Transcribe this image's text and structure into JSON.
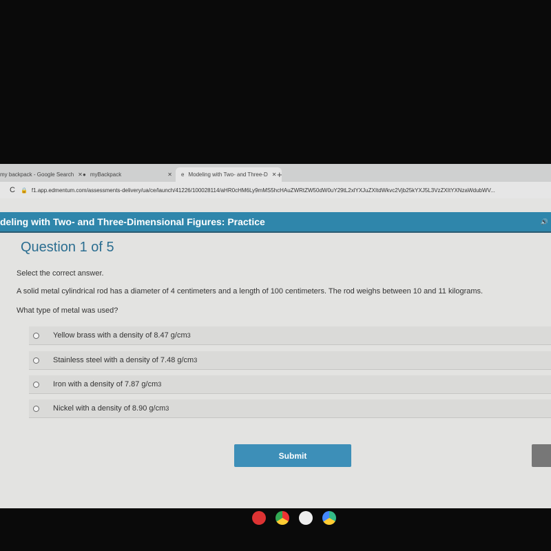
{
  "browser": {
    "tabs": [
      {
        "label": "my backpack - Google Search"
      },
      {
        "label": "myBackpack"
      },
      {
        "label": "Modeling with Two- and Three-D"
      }
    ],
    "url": "f1.app.edmentum.com/assessments-delivery/ua/ce/launch/41226/100028114/aHR0cHM6Ly9mMS5hcHAuZWRtZW50dW0uY29tL2xlYXJuZXItdWkvc2Vjb25kYXJ5L3VzZXItYXNzaWdubWV..."
  },
  "header": {
    "title": "deling with Two- and Three-Dimensional Figures: Practice"
  },
  "question": {
    "number": "Question 1 of 5",
    "instruction": "Select the correct answer.",
    "text": "A solid metal cylindrical rod has a diameter of 4 centimeters and a length of 100 centimeters. The rod weighs between 10 and 11 kilograms.",
    "prompt": "What type of metal was used?",
    "options": [
      {
        "label": "Yellow brass with a density of 8.47 g/cm",
        "sup": "3"
      },
      {
        "label": "Stainless steel with a density of 7.48 g/cm",
        "sup": "3"
      },
      {
        "label": "Iron with a density of 7.87 g/cm",
        "sup": "3"
      },
      {
        "label": "Nickel with a density of 8.90 g/cm",
        "sup": "3"
      }
    ]
  },
  "submit_label": "Submit",
  "colors": {
    "header": "#2f86ab",
    "submit": "#3d8fb8"
  }
}
